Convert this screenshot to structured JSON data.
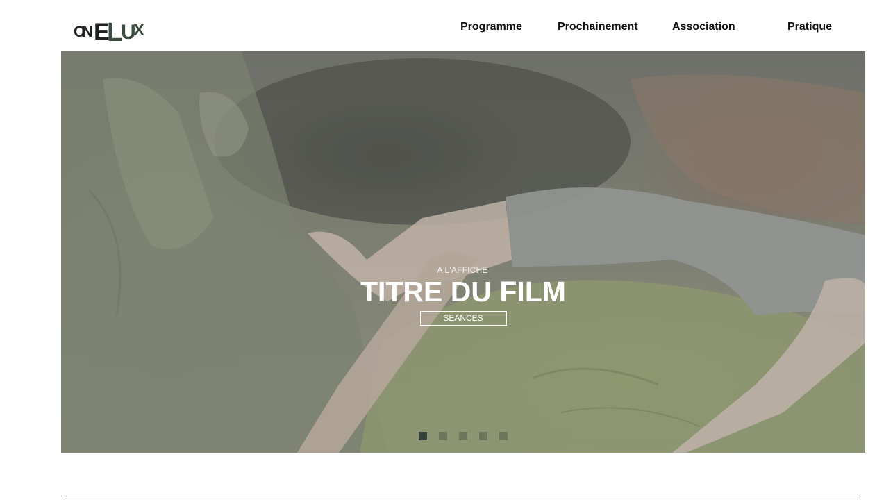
{
  "logo": {
    "text": "CINELUX"
  },
  "nav": {
    "items": [
      {
        "label": "Programme"
      },
      {
        "label": "Prochainement"
      },
      {
        "label": "Association"
      },
      {
        "label": "Pratique"
      }
    ]
  },
  "hero": {
    "kicker": "A L'AFFICHE",
    "title": "TITRE DU FILM",
    "button_label": "SEANCES",
    "slider": {
      "slide_count": 5,
      "active_index": 0
    }
  },
  "colors": {
    "text_dark": "#111111",
    "logo_accent": "#3a4a3e",
    "active_dot": "#34403a",
    "white": "#ffffff"
  }
}
